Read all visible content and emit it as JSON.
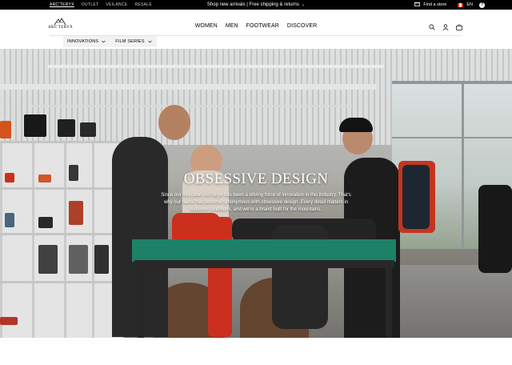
{
  "topbar": {
    "brands": [
      "ARC'TERYX",
      "OUTLET",
      "VEILANCE",
      "RESALE"
    ],
    "active_brand": "ARC'TERYX",
    "promo": "Shop new arrivals | Free shipping & returns",
    "find_store": "Find a store",
    "language": "EN",
    "help": "?"
  },
  "header": {
    "logo_text": "ARC'TERYX",
    "nav": [
      "WOMEN",
      "MEN",
      "FOOTWEAR",
      "DISCOVER"
    ],
    "icons": [
      "search-icon",
      "account-icon",
      "cart-icon"
    ]
  },
  "subnav": {
    "items": [
      {
        "label": "INNOVATIONS"
      },
      {
        "label": "FILM SERIES"
      }
    ]
  },
  "hero": {
    "title": "OBSESSIVE DESIGN",
    "body": "Since our inception, Arc'teryx has been a driving force of innovation in this industry. That's why our name has become synonymous with obsessive design. Every detail matters in extreme conditions, and we're a brand built for the mountains."
  },
  "colors": {
    "topbar": "#000000",
    "accent_red": "#d8321f",
    "table_green": "#1f8a6e"
  }
}
